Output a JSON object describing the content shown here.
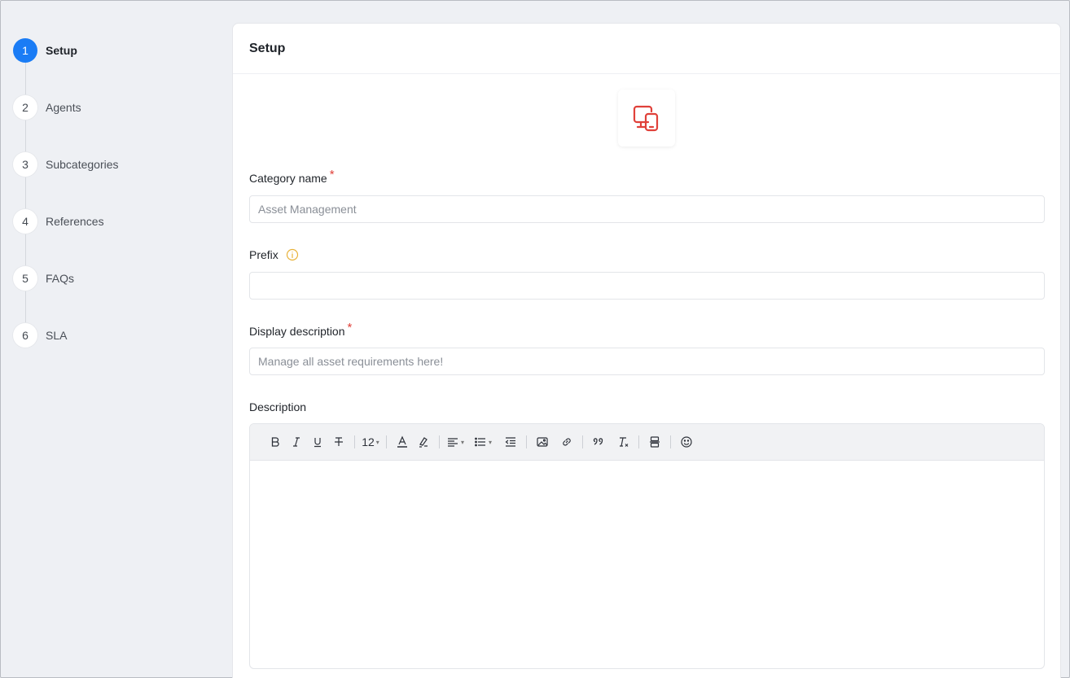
{
  "steps": [
    {
      "num": "1",
      "label": "Setup",
      "active": true
    },
    {
      "num": "2",
      "label": "Agents",
      "active": false
    },
    {
      "num": "3",
      "label": "Subcategories",
      "active": false
    },
    {
      "num": "4",
      "label": "References",
      "active": false
    },
    {
      "num": "5",
      "label": "FAQs",
      "active": false
    },
    {
      "num": "6",
      "label": "SLA",
      "active": false
    }
  ],
  "card": {
    "title": "Setup",
    "category_icon": "devices-icon"
  },
  "fields": {
    "category_name": {
      "label": "Category name",
      "required_mark": "*",
      "placeholder": "Asset Management",
      "value": ""
    },
    "prefix": {
      "label": "Prefix",
      "placeholder": "",
      "value": "",
      "info_icon": "info-icon"
    },
    "display_description": {
      "label": "Display description",
      "required_mark": "*",
      "placeholder": "Manage all asset requirements here!",
      "value": ""
    },
    "description": {
      "label": "Description"
    }
  },
  "toolbar": {
    "font_size": "12"
  },
  "colors": {
    "accent": "#1a7cf5",
    "required": "#e0413a",
    "icon_red": "#e0413a",
    "info": "#e8b23a"
  }
}
